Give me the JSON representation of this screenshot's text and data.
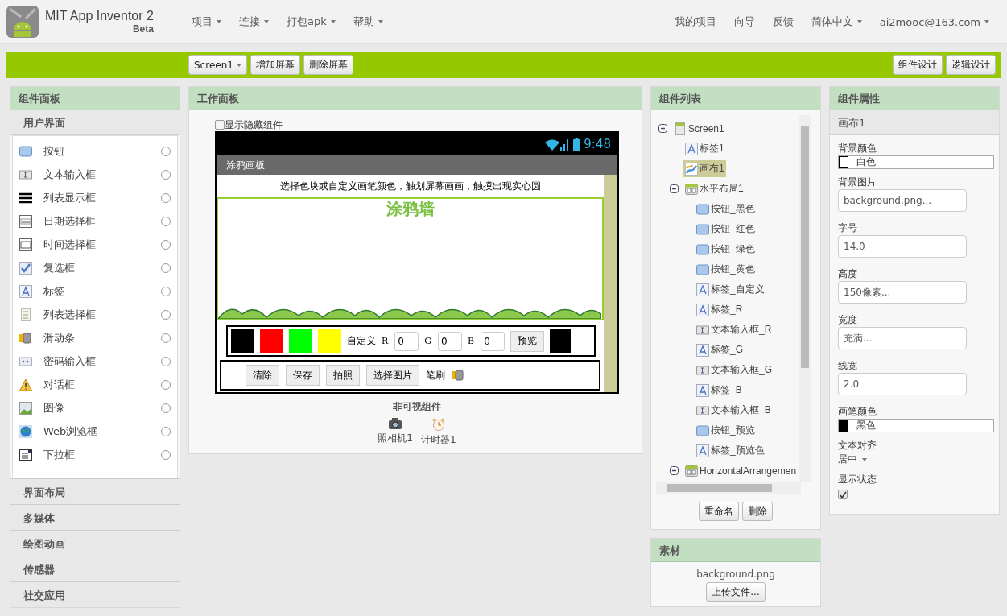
{
  "header": {
    "logo_title": "MIT App Inventor 2",
    "logo_subtitle": "Beta",
    "menus": [
      {
        "label": "项目",
        "dropdown": true
      },
      {
        "label": "连接",
        "dropdown": true
      },
      {
        "label": "打包apk",
        "dropdown": true
      },
      {
        "label": "帮助",
        "dropdown": true
      }
    ],
    "right_menus": [
      {
        "label": "我的项目",
        "dropdown": false
      },
      {
        "label": "向导",
        "dropdown": false
      },
      {
        "label": "反馈",
        "dropdown": false
      },
      {
        "label": "简体中文",
        "dropdown": true
      },
      {
        "label": "ai2mooc@163.com",
        "dropdown": true
      }
    ]
  },
  "toolbar": {
    "screen_select": "Screen1",
    "left_buttons": [
      "增加屏幕",
      "删除屏幕"
    ],
    "right_buttons": [
      "组件设计",
      "逻辑设计"
    ]
  },
  "palette": {
    "title": "组件面板",
    "open_category": "用户界面",
    "items": [
      {
        "label": "按钮",
        "kind": "button"
      },
      {
        "label": "文本输入框",
        "kind": "textbox"
      },
      {
        "label": "列表显示框",
        "kind": "listview"
      },
      {
        "label": "日期选择框",
        "kind": "datepicker"
      },
      {
        "label": "时间选择框",
        "kind": "timepicker"
      },
      {
        "label": "复选框",
        "kind": "checkbox"
      },
      {
        "label": "标签",
        "kind": "label"
      },
      {
        "label": "列表选择框",
        "kind": "listpicker"
      },
      {
        "label": "滑动条",
        "kind": "slider"
      },
      {
        "label": "密码输入框",
        "kind": "password"
      },
      {
        "label": "对话框",
        "kind": "notifier"
      },
      {
        "label": "图像",
        "kind": "image"
      },
      {
        "label": "Web浏览框",
        "kind": "web"
      },
      {
        "label": "下拉框",
        "kind": "spinner"
      }
    ],
    "categories": [
      "界面布局",
      "多媒体",
      "绘图动画",
      "传感器",
      "社交应用"
    ]
  },
  "viewer": {
    "title": "工作面板",
    "show_hidden": {
      "label": "显示隐藏组件",
      "checked": false
    },
    "phone": {
      "time": "9:48",
      "screen_title": "涂鸦画板",
      "instruction": "选择色块或自定义画笔颜色，触划屏幕画画，触摸出现实心圆",
      "canvas_banner": "涂鸦墙",
      "color_row": {
        "swatches": [
          {
            "color": "#000000"
          },
          {
            "color": "#ff0000"
          },
          {
            "color": "#00ff00"
          },
          {
            "color": "#ffff00"
          }
        ],
        "custom_label": "自定义",
        "channels": [
          {
            "label": "R",
            "value": "0"
          },
          {
            "label": "G",
            "value": "0"
          },
          {
            "label": "B",
            "value": "0"
          }
        ],
        "preview_button": "预览",
        "preview_swatch": {
          "color": "#000000"
        }
      },
      "action_row": {
        "buttons": [
          "清除",
          "保存",
          "拍照",
          "选择图片"
        ],
        "brush_label": "笔刷"
      }
    },
    "nonvisible_title": "非可视组件",
    "nonvisible": [
      {
        "label": "照相机1",
        "kind": "camera"
      },
      {
        "label": "计时器1",
        "kind": "timer"
      }
    ]
  },
  "components": {
    "title": "组件列表",
    "tree": [
      {
        "label": "Screen1",
        "kind": "screen",
        "selected": false,
        "expanded": true,
        "children": [
          {
            "label": "标签1",
            "kind": "label",
            "selected": false
          },
          {
            "label": "画布1",
            "kind": "canvas",
            "selected": true
          },
          {
            "label": "水平布局1",
            "kind": "arrangement",
            "selected": false,
            "expanded": true,
            "children": [
              {
                "label": "按钮_黑色",
                "kind": "button",
                "selected": false
              },
              {
                "label": "按钮_红色",
                "kind": "button",
                "selected": false
              },
              {
                "label": "按钮_绿色",
                "kind": "button",
                "selected": false
              },
              {
                "label": "按钮_黄色",
                "kind": "button",
                "selected": false
              },
              {
                "label": "标签_自定义",
                "kind": "label",
                "selected": false
              },
              {
                "label": "标签_R",
                "kind": "label",
                "selected": false
              },
              {
                "label": "文本输入框_R",
                "kind": "textbox",
                "selected": false
              },
              {
                "label": "标签_G",
                "kind": "label",
                "selected": false
              },
              {
                "label": "文本输入框_G",
                "kind": "textbox",
                "selected": false
              },
              {
                "label": "标签_B",
                "kind": "label",
                "selected": false
              },
              {
                "label": "文本输入框_B",
                "kind": "textbox",
                "selected": false
              },
              {
                "label": "按钮_预览",
                "kind": "button",
                "selected": false
              },
              {
                "label": "标签_预览色",
                "kind": "label",
                "selected": false
              }
            ]
          },
          {
            "label": "HorizontalArrangemen",
            "kind": "arrangement",
            "selected": false,
            "expanded": true
          }
        ]
      }
    ],
    "buttons": [
      "重命名",
      "删除"
    ]
  },
  "media": {
    "title": "素材",
    "files": [
      "background.png"
    ],
    "upload_button": "上传文件..."
  },
  "properties": {
    "title": "组件属性",
    "component": "画布1",
    "items": [
      {
        "label": "背景颜色",
        "kind": "color",
        "value": "白色",
        "color": "#ffffff"
      },
      {
        "label": "背景图片",
        "kind": "field",
        "value": "background.png..."
      },
      {
        "label": "字号",
        "kind": "field",
        "value": "14.0"
      },
      {
        "label": "高度",
        "kind": "field",
        "value": "150像素..."
      },
      {
        "label": "宽度",
        "kind": "field",
        "value": "充满..."
      },
      {
        "label": "线宽",
        "kind": "field",
        "value": "2.0"
      },
      {
        "label": "画笔颜色",
        "kind": "color",
        "value": "黑色",
        "color": "#000000"
      },
      {
        "label": "文本对齐",
        "kind": "dropdown",
        "value": "居中"
      },
      {
        "label": "显示状态",
        "kind": "checkbox",
        "checked": true
      }
    ]
  }
}
